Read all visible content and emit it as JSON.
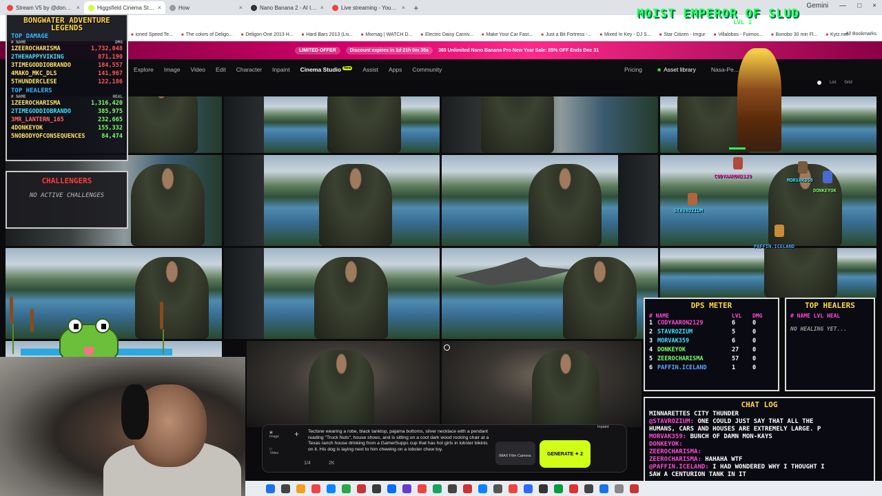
{
  "browser": {
    "tabs": [
      {
        "label": "Stream V5 by @dongbongwat",
        "active": false
      },
      {
        "label": "Higgsfield Cinema Studio | Pro",
        "active": true
      },
      {
        "label": "How",
        "active": false
      },
      {
        "label": "Nano Banana 2 - AI Image Gen",
        "active": false
      },
      {
        "label": "Live streaming - YouTube Studio",
        "active": false
      }
    ],
    "right_tab": "Gemini",
    "bookmarks": [
      "ioned Speed Te...",
      "The colors of Deligo...",
      "Deligon One 2013 H...",
      "Hard Bars 2013 (Liv...",
      "Mixmag | WATCH D...",
      "Electric Daisy Carniv...",
      "Make Your Car Fast...",
      "Just a Bit Fortress -...",
      "Mixed In Key - DJ S...",
      "Star Citizen - Imgur",
      "Villalobos - Fuimos...",
      "Bonobo 30 min Fl...",
      "Kytz.net"
    ],
    "all_bookmarks": "All Bookmarks"
  },
  "promo": {
    "limited": "LIMITED OFFER",
    "discount": "Discount expires in 1d 21h 0m 35s",
    "message": "365 Unlimited Nano Banana Pro New Year Sale: 85% OFF Ends Dec 31"
  },
  "nav": {
    "links": [
      "Explore",
      "Image",
      "Video",
      "Edit",
      "Character",
      "Inpaint",
      "Cinema Studio",
      "Assist",
      "Apps",
      "Community"
    ],
    "new_badge": "New",
    "pricing": "Pricing",
    "asset_library": "Asset library",
    "user": "Nasa-Pe...",
    "view_list": "List",
    "view_grid": "Grid"
  },
  "leaderboard": {
    "title": "BONGWATER ADVENTURE LEGENDS",
    "damage_title": "TOP DAMAGE",
    "col_name": "# NAME",
    "col_dmg": "DMG",
    "damage": [
      {
        "rank": "1",
        "name": "ZEEROCHARISMA",
        "value": "1,732,048"
      },
      {
        "rank": "2",
        "name": "THEHAPPYVIKING",
        "value": "871,190"
      },
      {
        "rank": "3",
        "name": "TIMEGODDIOBRANDO",
        "value": "184,557"
      },
      {
        "rank": "4",
        "name": "MAKO_MKC_DLS",
        "value": "141,967"
      },
      {
        "rank": "5",
        "name": "THUNDERCLESE",
        "value": "122,186"
      }
    ],
    "healers_title": "TOP HEALERS",
    "col_heal": "HEAL",
    "healers": [
      {
        "rank": "1",
        "name": "ZEEROCHARISMA",
        "value": "1,316,420"
      },
      {
        "rank": "2",
        "name": "TIMEGODDIOBRANDO",
        "value": "385,975"
      },
      {
        "rank": "3",
        "name": "MR_LANTERN_165",
        "value": "232,665"
      },
      {
        "rank": "4",
        "name": "DONKEYOK",
        "value": "155,332"
      },
      {
        "rank": "5",
        "name": "NOBODYOFCONSEQUENCES",
        "value": "84,474"
      }
    ]
  },
  "challengers": {
    "title": "CHALLENGERS",
    "empty": "NO ACTIVE CHALLENGES"
  },
  "emperor": {
    "name": "MOIST EMPEROR OF SLUD",
    "level": "LVL 1"
  },
  "avatars": [
    {
      "name": "CODYAARON2129",
      "color": "#ff4ad2"
    },
    {
      "name": "MORVAK359",
      "color": "#3fe0ff"
    },
    {
      "name": "DONKEYOK",
      "color": "#7cff6b"
    },
    {
      "name": "STAVROZIUM",
      "color": "#3fe0ff"
    },
    {
      "name": "PAFFIN.ICELAND",
      "color": "#5aa8ff"
    }
  ],
  "dps_meter": {
    "title": "DPS METER",
    "col_name": "# NAME",
    "col_lvl": "LVL",
    "col_dmg": "DMG",
    "rows": [
      {
        "rank": "1",
        "name": "CODYAARON2129",
        "lvl": "6",
        "dmg": "0",
        "color": "#ff4ad2"
      },
      {
        "rank": "2",
        "name": "STAVROZIUM",
        "lvl": "5",
        "dmg": "0",
        "color": "#3fe0ff"
      },
      {
        "rank": "3",
        "name": "MORVAK359",
        "lvl": "6",
        "dmg": "0",
        "color": "#3fe0ff"
      },
      {
        "rank": "4",
        "name": "DONKEYOK",
        "lvl": "27",
        "dmg": "0",
        "color": "#7cff6b"
      },
      {
        "rank": "5",
        "name": "ZEEROCHARISMA",
        "lvl": "57",
        "dmg": "0",
        "color": "#7cff6b"
      },
      {
        "rank": "6",
        "name": "PAFFIN.ICELAND",
        "lvl": "1",
        "dmg": "0",
        "color": "#5aa8ff"
      }
    ]
  },
  "top_healers_panel": {
    "title": "TOP HEALERS",
    "head": "# NAME LVL HEAL",
    "empty": "NO HEALING YET..."
  },
  "chat": {
    "title": "CHAT LOG",
    "lines": [
      {
        "user": "",
        "text": "MINNARETTES CITY THUNDER"
      },
      {
        "user": "@STAVROZIUM:",
        "text": "ONE COULD JUST SAY THAT ALL THE"
      },
      {
        "user": "",
        "text": "HUMANS, CARS AND HOUSES ARE EXTREMELY LARGE. P"
      },
      {
        "user": "MORVAK359:",
        "text": "BUNCH OF DAMN MON-KAYS"
      },
      {
        "user": "DONKEYOK:",
        "text": ""
      },
      {
        "user": "ZEEROCHARISMA:",
        "text": ""
      },
      {
        "user": "ZEEROCHARISMA:",
        "text": "HAHAHA WTF"
      },
      {
        "user": "@PAFFIN.ICELAND:",
        "text": "I HAD WONDERED WHY I THOUGHT I"
      },
      {
        "user": "",
        "text": "SAW A CENTURION TANK IN IT"
      }
    ]
  },
  "prompt": {
    "text": "Tectone wearing a robe, black tanktop, pajama bottoms, silver necklace with a pendant reading \"Truck Nuts\", house shoes, and is sitting on a cool dark wood rocking chair at a Texas ranch house drinking from a GamerSupps cup that has hot girls in lobster bikinis on it. His dog is laying next to him chewing on a lobster chew toy.",
    "count": "1/4",
    "resolution": "2K",
    "camera": "IMAX Film Camera",
    "generate": "GENERATE",
    "generate_cost": "2",
    "side_image": "Image",
    "side_video": "Video",
    "tools": "Inpaint"
  }
}
